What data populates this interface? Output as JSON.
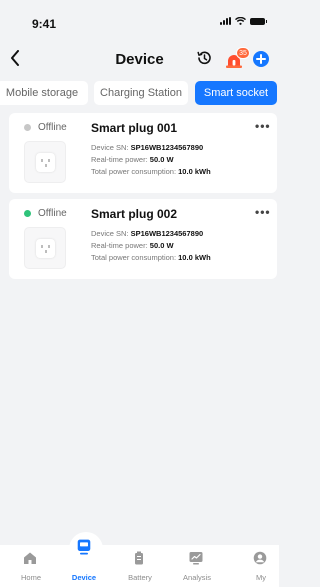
{
  "status_bar": {
    "time": "9:41"
  },
  "nav": {
    "title": "Device",
    "alarm_count": "35"
  },
  "colors": {
    "accent": "#1677ff",
    "online": "#2ec37a",
    "offline": "#c7c7c7",
    "badge": "#ff6a3d"
  },
  "tabs": [
    {
      "label": "Mobile storage",
      "active": false
    },
    {
      "label": "Charging Station",
      "active": false
    },
    {
      "label": "Smart socket",
      "active": true
    }
  ],
  "devices": [
    {
      "status": "Offline",
      "name": "Smart plug 001",
      "sn_label": "Device SN: ",
      "sn": "SP16WB1234567890",
      "power_label": "Real-time power: ",
      "power": "50.0 W",
      "total_label": "Total power consumption: ",
      "total": "10.0 kWh"
    },
    {
      "status": "Offline",
      "name": "Smart plug 002",
      "sn_label": "Device SN: ",
      "sn": "SP16WB1234567890",
      "power_label": "Real-time power: ",
      "power": "50.0 W",
      "total_label": "Total power consumption: ",
      "total": "10.0 kWh"
    }
  ],
  "tab_bar": [
    {
      "label": "Home",
      "icon": "home-icon"
    },
    {
      "label": "Device",
      "icon": "device-icon",
      "active": true
    },
    {
      "label": "Battery",
      "icon": "battery-icon"
    },
    {
      "label": "Analysis",
      "icon": "analysis-icon"
    },
    {
      "label": "My",
      "icon": "profile-icon"
    }
  ]
}
